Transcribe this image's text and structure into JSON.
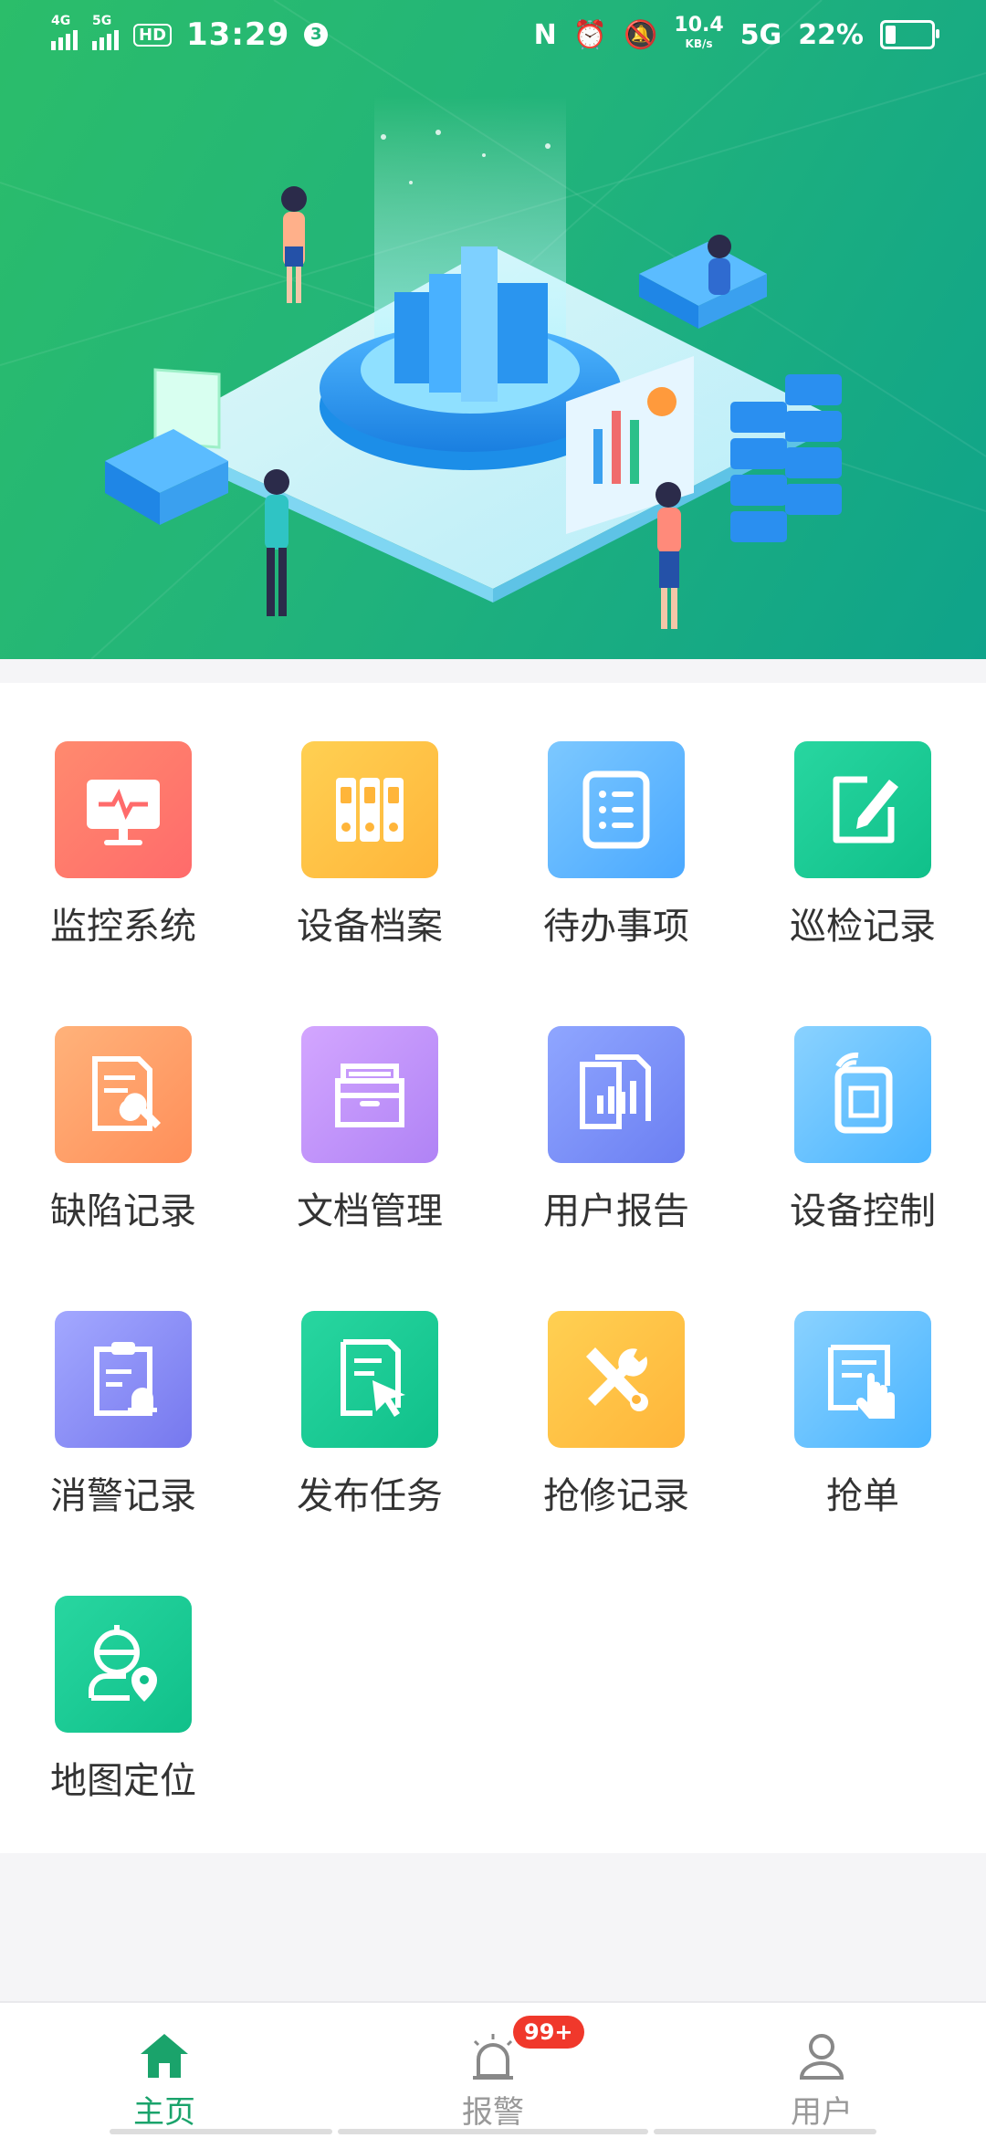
{
  "status_bar": {
    "time": "13:29",
    "notification_count": "3",
    "sig1_label": "4G",
    "sig2_label": "5G",
    "hd_label": "HD",
    "net_speed": "10.4",
    "net_unit": "KB/s",
    "net_type": "5G",
    "battery": "22%",
    "battery_level": 0.22
  },
  "colors": {
    "accent": "#1aa36b",
    "badge": "#f0382b"
  },
  "menu": [
    {
      "label": "监控系统",
      "icon": "monitor-icon",
      "color_from": "#ff8a6e",
      "color_to": "#ff6b6b"
    },
    {
      "label": "设备档案",
      "icon": "binders-icon",
      "color_from": "#ffd052",
      "color_to": "#ffb53a"
    },
    {
      "label": "待办事项",
      "icon": "list-icon",
      "color_from": "#7cc8ff",
      "color_to": "#4aa8ff"
    },
    {
      "label": "巡检记录",
      "icon": "edit-icon",
      "color_from": "#28d6a0",
      "color_to": "#10c08a"
    },
    {
      "label": "缺陷记录",
      "icon": "doc-wrench-icon",
      "color_from": "#ffb27a",
      "color_to": "#ff8f5a"
    },
    {
      "label": "文档管理",
      "icon": "folder-icon",
      "color_from": "#d3a6ff",
      "color_to": "#b083f5"
    },
    {
      "label": "用户报告",
      "icon": "report-icon",
      "color_from": "#8fa6ff",
      "color_to": "#6c7ff2"
    },
    {
      "label": "设备控制",
      "icon": "device-icon",
      "color_from": "#8ad2ff",
      "color_to": "#4ab4ff"
    },
    {
      "label": "消警记录",
      "icon": "clipboard-bell-icon",
      "color_from": "#a3a8ff",
      "color_to": "#7678ee"
    },
    {
      "label": "发布任务",
      "icon": "doc-cursor-icon",
      "color_from": "#28d6a0",
      "color_to": "#10c08a"
    },
    {
      "label": "抢修记录",
      "icon": "tools-icon",
      "color_from": "#ffd052",
      "color_to": "#ffb53a"
    },
    {
      "label": "抢单",
      "icon": "tap-doc-icon",
      "color_from": "#8ad2ff",
      "color_to": "#4ab4ff"
    },
    {
      "label": "地图定位",
      "icon": "worker-location-icon",
      "color_from": "#28d6a0",
      "color_to": "#10c08a"
    }
  ],
  "tabbar": {
    "home": "主页",
    "alarm": "报警",
    "alarm_badge": "99+",
    "user": "用户"
  }
}
